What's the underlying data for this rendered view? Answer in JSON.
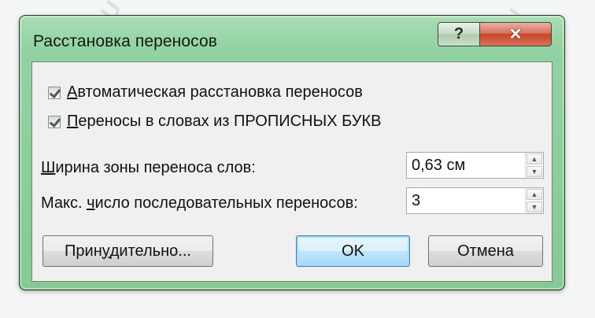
{
  "window": {
    "title": "Расстановка переносов",
    "help_label": "?",
    "close_label": "✕"
  },
  "options": {
    "auto_hyphenate_label_first": "А",
    "auto_hyphenate_label_rest": "втоматическая расстановка переносов",
    "auto_hyphenate_checked": true,
    "caps_label_first": "П",
    "caps_label_rest": "ереносы в словах из ПРОПИСНЫХ БУКВ",
    "caps_checked": true
  },
  "zone": {
    "label_pre": "Ш",
    "label_rest": "ирина зоны переноса слов:",
    "value": "0,63 см"
  },
  "limit": {
    "label_pre": "Макс. ",
    "label_u": "ч",
    "label_rest": "исло последовательных переносов:",
    "value": "3"
  },
  "buttons": {
    "manual_pre": "Прин",
    "manual_u": "у",
    "manual_rest": "дительно...",
    "ok": "OK",
    "cancel": "Отмена"
  },
  "watermark": "SET-OS.RU"
}
